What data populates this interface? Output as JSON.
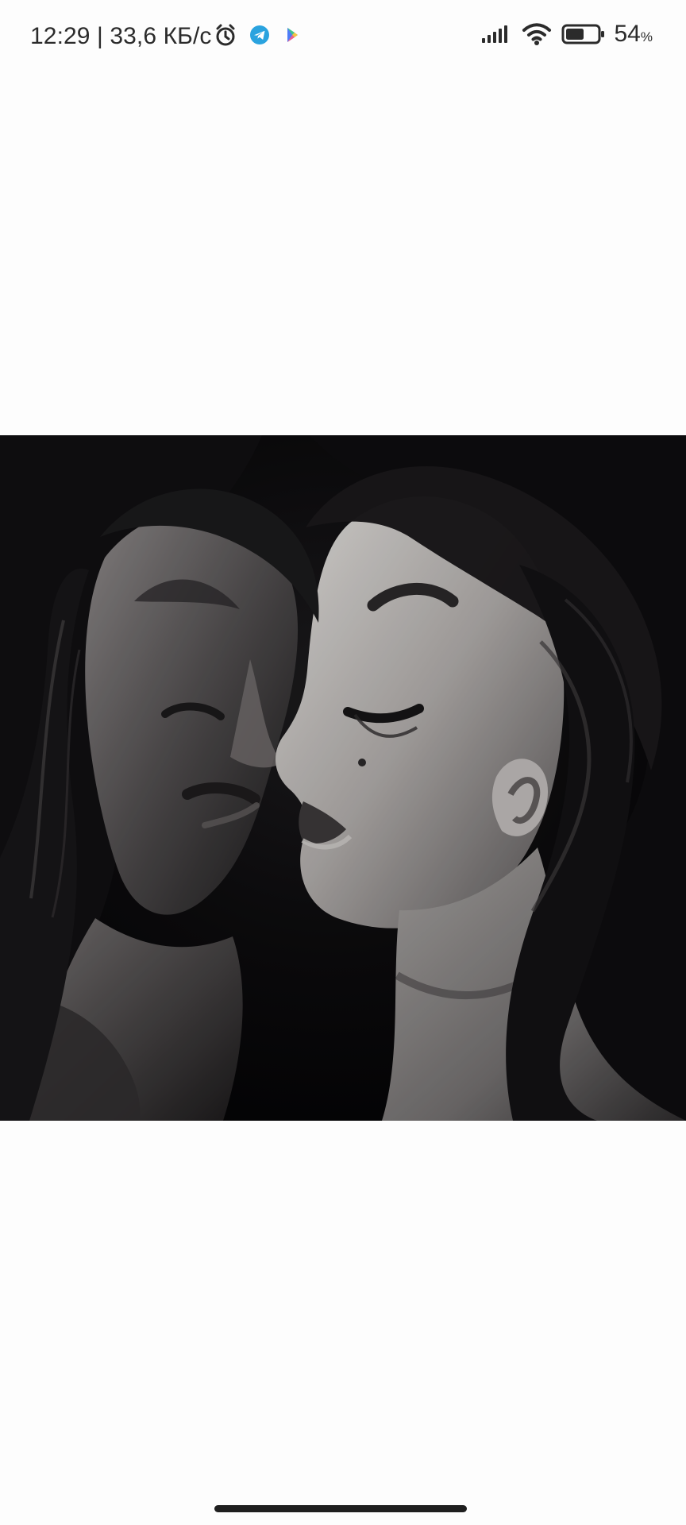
{
  "status_bar": {
    "time": "12:29",
    "separator": "|",
    "network_speed": "33,6 КБ/с",
    "battery_level": "54",
    "battery_unit": "%",
    "icons_left": [
      "alarm-icon",
      "telegram-icon",
      "play-store-icon"
    ],
    "icons_right": [
      "signal-icon",
      "wifi-icon",
      "battery-icon"
    ]
  },
  "media": {
    "image_type": "black-and-white portrait photograph"
  },
  "navigation": {
    "home_indicator": "home-indicator"
  },
  "colors": {
    "status_text": "#2b2b2b",
    "background": "#fdfdfd",
    "photo_dark": "#070607",
    "telegram": "#2aa3df",
    "play_blue": "#4e7cf7",
    "play_pink": "#ef5f8e",
    "play_yellow": "#f5c542"
  }
}
